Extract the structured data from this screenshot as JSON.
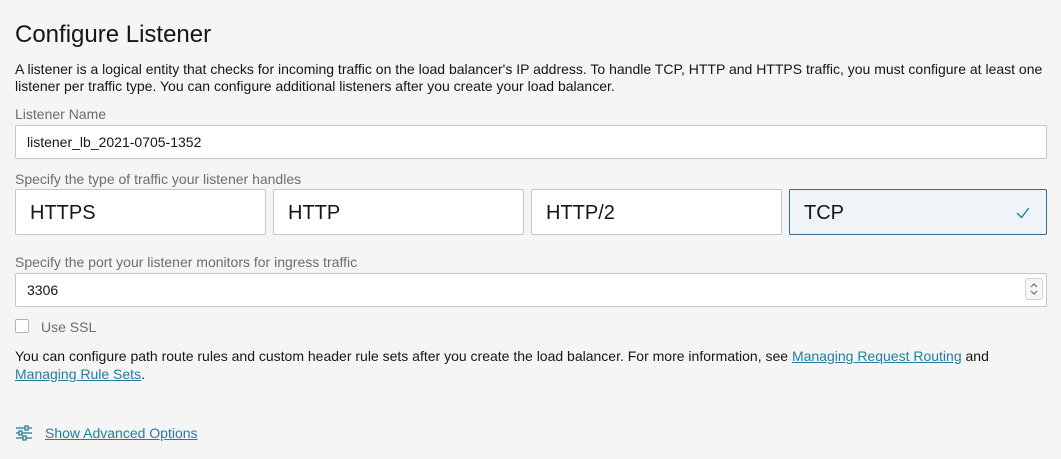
{
  "header": {
    "title": "Configure Listener",
    "description": "A listener is a logical entity that checks for incoming traffic on the load balancer's IP address. To handle TCP, HTTP and HTTPS traffic, you must configure at least one listener per traffic type. You can configure additional listeners after you create your load balancer."
  },
  "listener_name": {
    "label": "Listener Name",
    "value": "listener_lb_2021-0705-1352"
  },
  "traffic_type": {
    "label": "Specify the type of traffic your listener handles",
    "options": [
      {
        "label": "HTTPS",
        "selected": false
      },
      {
        "label": "HTTP",
        "selected": false
      },
      {
        "label": "HTTP/2",
        "selected": false
      },
      {
        "label": "TCP",
        "selected": true
      }
    ],
    "selected_value": "TCP"
  },
  "port": {
    "label": "Specify the port your listener monitors for ingress traffic",
    "value": "3306"
  },
  "ssl": {
    "label": "Use SSL",
    "checked": false
  },
  "routing_info": {
    "text_before": "You can configure path route rules and custom header rule sets after you create the load balancer. For more information, see ",
    "link1": "Managing Request Routing",
    "text_middle": " and ",
    "link2": "Managing Rule Sets",
    "text_after": "."
  },
  "advanced": {
    "label": "Show Advanced Options",
    "icon": "sliders-icon"
  },
  "colors": {
    "background": "#f5f5f5",
    "link": "#227e9e",
    "selected_tile_bg": "#eef4f8",
    "selected_tile_border": "#3d6b8c",
    "check": "#227e9e"
  }
}
